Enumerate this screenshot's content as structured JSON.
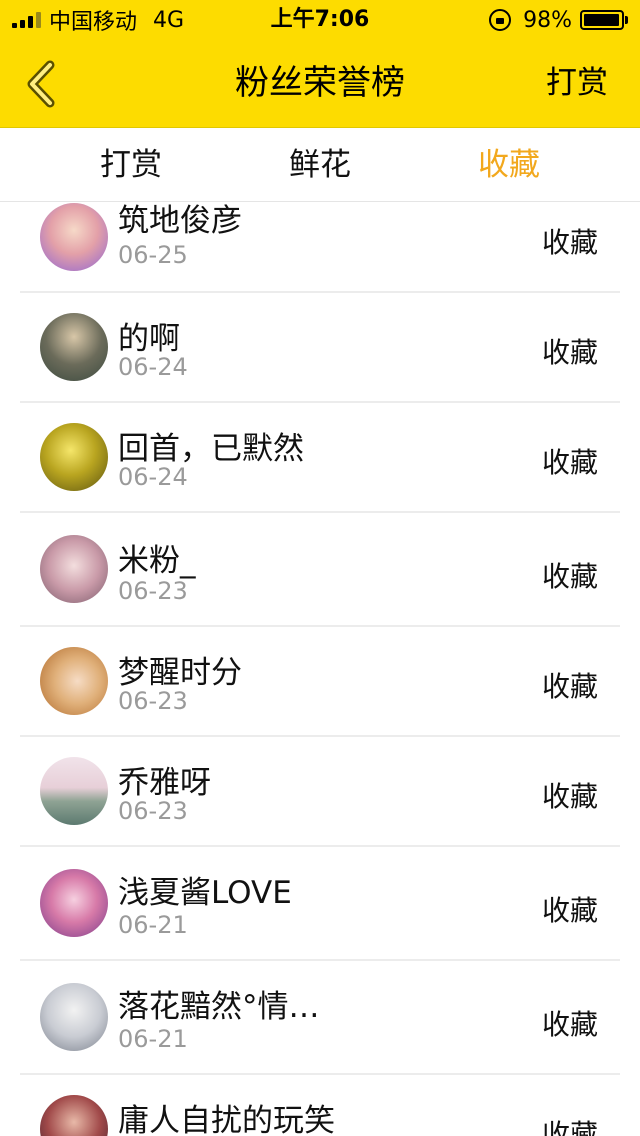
{
  "status_bar": {
    "carrier": "中国移动",
    "network": "4G",
    "time": "上午7:06",
    "battery": "98%",
    "battery_level": 0.98
  },
  "nav": {
    "back_icon": "chevron-left-icon",
    "title": "粉丝荣誉榜",
    "right_link": "打赏"
  },
  "tabs": [
    {
      "label": "打赏",
      "active": false
    },
    {
      "label": "鲜花",
      "active": false
    },
    {
      "label": "收藏",
      "active": true
    }
  ],
  "colors": {
    "header_bg": "#fddc00",
    "active_tab": "#f2a81d",
    "date_text": "#9a9a9a",
    "divider": "#ececec"
  },
  "fans": [
    {
      "name": "筑地俊彦",
      "date": "06-25",
      "action": "收藏"
    },
    {
      "name": "的啊",
      "date": "06-24",
      "action": "收藏"
    },
    {
      "name": "回首，已默然",
      "date": "06-24",
      "action": "收藏"
    },
    {
      "name": "米粉_",
      "date": "06-23",
      "action": "收藏"
    },
    {
      "name": "梦醒时分",
      "date": "06-23",
      "action": "收藏"
    },
    {
      "name": "乔雅呀",
      "date": "06-23",
      "action": "收藏"
    },
    {
      "name": "浅夏酱LOVE",
      "date": "06-21",
      "action": "收藏"
    },
    {
      "name": "落花黯然°情…",
      "date": "06-21",
      "action": "收藏"
    },
    {
      "name": "庸人自扰的玩笑",
      "date": "",
      "action": "收藏"
    }
  ]
}
